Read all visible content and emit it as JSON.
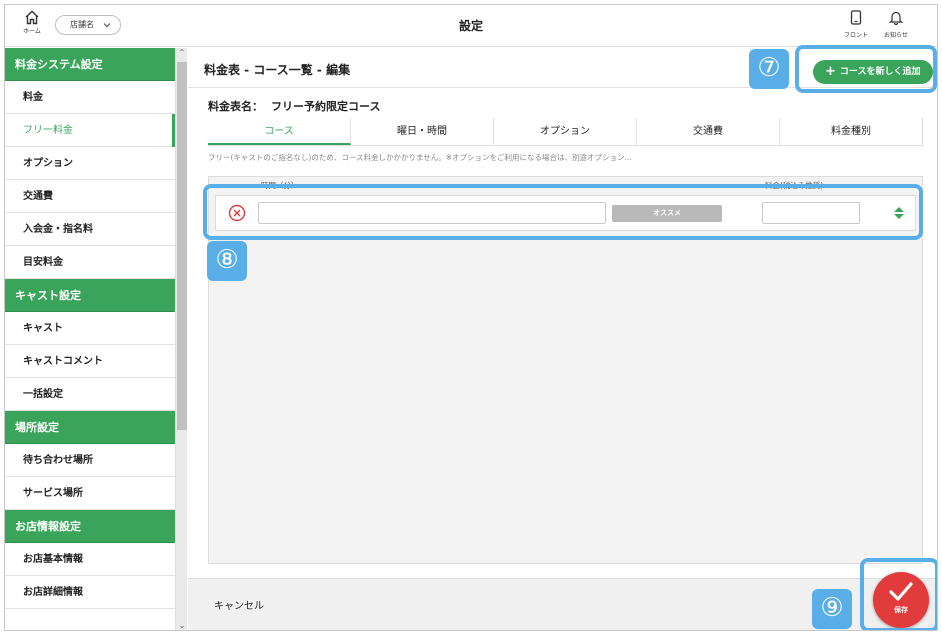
{
  "topbar": {
    "home_label": "ホーム",
    "store_select": "店舗名",
    "title": "設定",
    "front_label": "フロント",
    "notice_label": "お知らせ"
  },
  "sidebar": {
    "sections": [
      {
        "heading": "料金システム設定",
        "items": [
          "料金",
          "フリー料金",
          "オプション",
          "交通費",
          "入会金・指名料",
          "目安料金"
        ]
      },
      {
        "heading": "キャスト設定",
        "items": [
          "キャスト",
          "キャストコメント",
          "一括設定"
        ]
      },
      {
        "heading": "場所設定",
        "items": [
          "待ち合わせ場所",
          "サービス場所"
        ]
      },
      {
        "heading": "お店情報設定",
        "items": [
          "お店基本情報",
          "お店詳細情報"
        ]
      }
    ],
    "active_item": "フリー料金"
  },
  "content": {
    "title": "料金表 - コース一覧 - 編集",
    "add_button": "コースを新しく追加",
    "fee_name_label": "料金表名：",
    "fee_name_value": "フリー予約限定コース",
    "tabs": [
      "コース",
      "曜日・時間",
      "オプション",
      "交通費",
      "料金種別"
    ],
    "active_tab": "コース",
    "note": "フリー(キャストのご指名なし)のため、コース料金しかかかりません。※オプションをご利用になる場合は、別途オプション…",
    "columns": {
      "time": "時間（分）",
      "price": "料金(税込み推奨)"
    },
    "row": {
      "time_value": "",
      "recommend_label": "オススメ",
      "price_value": ""
    },
    "cancel": "キャンセル",
    "save": "保存"
  },
  "annotations": {
    "add": "⑦",
    "row": "⑧",
    "save": "⑨"
  },
  "colors": {
    "accent": "#3aa55a",
    "danger": "#e13b3b",
    "annotation": "#5aaee8"
  },
  "icons": [
    "home-icon",
    "chevron-down-icon",
    "phone-icon",
    "bell-icon",
    "plus-icon",
    "delete-icon",
    "sort-icon",
    "check-icon"
  ]
}
